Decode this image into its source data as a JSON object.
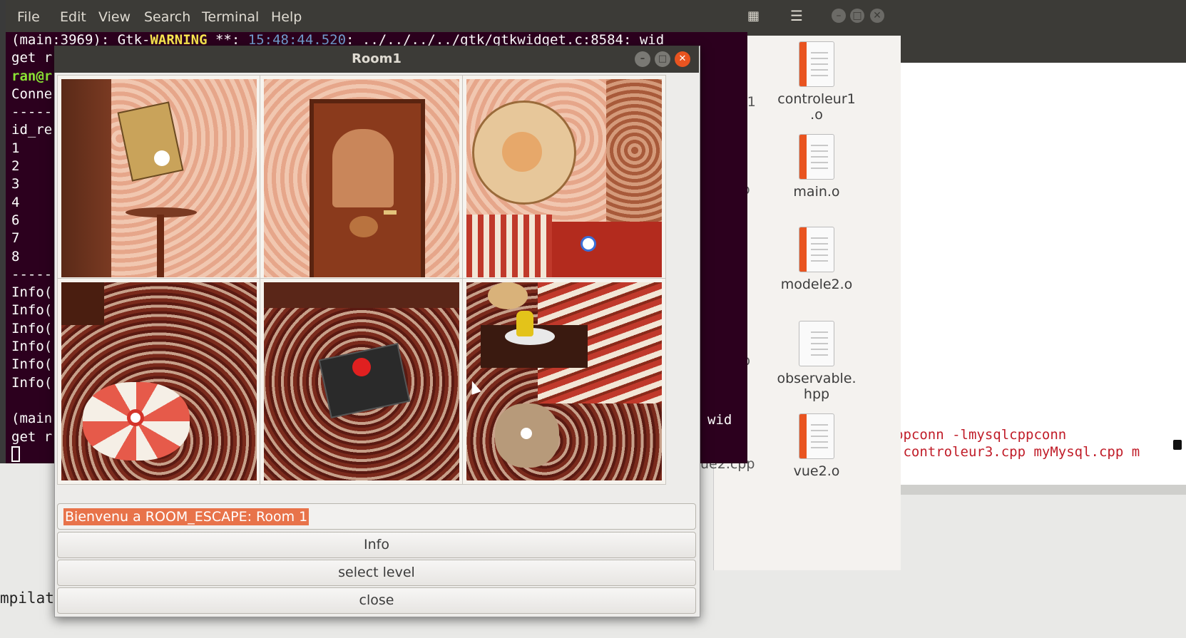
{
  "terminal": {
    "menu": [
      "File",
      "Edit",
      "View",
      "Search",
      "Terminal",
      "Help"
    ],
    "lines": [
      {
        "parts": [
          {
            "t": "(main:3969): Gtk-",
            "c": ""
          },
          {
            "t": "WARNING",
            "c": "yellow"
          },
          {
            "t": " **: ",
            "c": ""
          },
          {
            "t": "15:48:44.520",
            "c": "blue"
          },
          {
            "t": ": ../../../../gtk/gtkwidget.c:8584: wid",
            "c": ""
          }
        ]
      },
      {
        "parts": [
          {
            "t": "get r",
            "c": ""
          }
        ]
      },
      {
        "parts": [
          {
            "t": "ran@r",
            "c": "green"
          }
        ]
      },
      {
        "parts": [
          {
            "t": "Conne",
            "c": ""
          }
        ]
      },
      {
        "parts": [
          {
            "t": "-----",
            "c": ""
          }
        ]
      },
      {
        "parts": [
          {
            "t": "id_re",
            "c": ""
          }
        ]
      },
      {
        "parts": [
          {
            "t": "1",
            "c": ""
          }
        ]
      },
      {
        "parts": [
          {
            "t": "2",
            "c": ""
          }
        ]
      },
      {
        "parts": [
          {
            "t": "3",
            "c": ""
          }
        ]
      },
      {
        "parts": [
          {
            "t": "4",
            "c": ""
          }
        ]
      },
      {
        "parts": [
          {
            "t": "6",
            "c": ""
          }
        ]
      },
      {
        "parts": [
          {
            "t": "7",
            "c": ""
          }
        ]
      },
      {
        "parts": [
          {
            "t": "8",
            "c": ""
          }
        ]
      },
      {
        "parts": [
          {
            "t": "-----",
            "c": ""
          }
        ]
      },
      {
        "parts": [
          {
            "t": "Info(",
            "c": ""
          }
        ]
      },
      {
        "parts": [
          {
            "t": "Info(",
            "c": ""
          }
        ]
      },
      {
        "parts": [
          {
            "t": "Info(",
            "c": ""
          }
        ]
      },
      {
        "parts": [
          {
            "t": "Info(",
            "c": ""
          }
        ]
      },
      {
        "parts": [
          {
            "t": "Info(",
            "c": ""
          }
        ]
      },
      {
        "parts": [
          {
            "t": "Info(",
            "c": ""
          }
        ]
      },
      {
        "parts": [
          {
            "t": "",
            "c": ""
          }
        ]
      },
      {
        "parts": [
          {
            "t": "(main",
            "c": ""
          }
        ]
      },
      {
        "parts": [
          {
            "t": "get r",
            "c": ""
          }
        ]
      }
    ],
    "right_fragment": "wid",
    "bottom_left_text": "mpilat"
  },
  "file_manager": {
    "files": [
      {
        "name": "controleur1\n.o",
        "orange": true
      },
      {
        "name": "main.o",
        "orange": true
      },
      {
        "name": "modele2.o",
        "orange": true
      },
      {
        "name": "observable.\nhpp",
        "orange": false
      },
      {
        "name": "vue2.o",
        "orange": true
      }
    ],
    "partial_labels": [
      "r1",
      "o",
      ".",
      "p",
      "ue2.cpp"
    ]
  },
  "editor": {
    "line1": "ppconn -lmysqlcppconn",
    "line2": " controleur3.cpp myMysql.cpp m"
  },
  "dialog": {
    "title": "Room1",
    "message": "Bienvenu a ROOM_ESCAPE: Room 1",
    "buttons": {
      "info": "Info",
      "select_level": "select level",
      "close": "close"
    },
    "tiles": [
      "poster-desk",
      "door",
      "wall-clock-sofa",
      "carpet-box",
      "carpet-keypad",
      "sofa-teddy-guitar"
    ]
  },
  "colors": {
    "terminal_bg": "#2c001e",
    "accent": "#e95420",
    "title_bar": "#3c3b37"
  }
}
